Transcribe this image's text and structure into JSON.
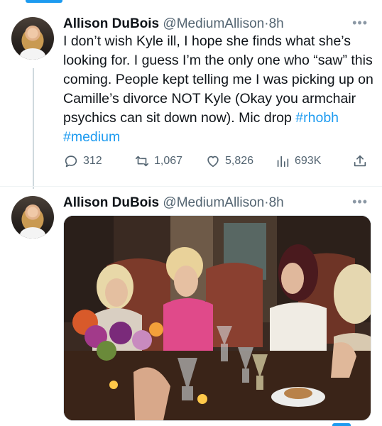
{
  "tweets": [
    {
      "author": {
        "name": "Allison DuBois",
        "handle": "@MediumAllison",
        "time": "8h"
      },
      "text": {
        "body": "I don’t wish Kyle ill, I hope she finds what she’s looking for. I guess I’m the only one who “saw” this coming. People kept telling me I was picking up on Camille’s divorce NOT Kyle (Okay you armchair psychics can sit down now). Mic drop",
        "hashtags": [
          "#rhobh",
          "#medium"
        ]
      },
      "actions": {
        "replies": "312",
        "retweets": "1,067",
        "likes": "5,826",
        "views": "693K"
      }
    },
    {
      "author": {
        "name": "Allison DuBois",
        "handle": "@MediumAllison",
        "time": "8h"
      }
    }
  ],
  "icons": {
    "reply": "reply-icon",
    "retweet": "retweet-icon",
    "like": "heart-icon",
    "views": "views-icon",
    "share": "share-icon",
    "more": "more-icon"
  },
  "colors": {
    "accent": "#1d9bf0",
    "muted": "#536471",
    "text": "#0f1419"
  }
}
